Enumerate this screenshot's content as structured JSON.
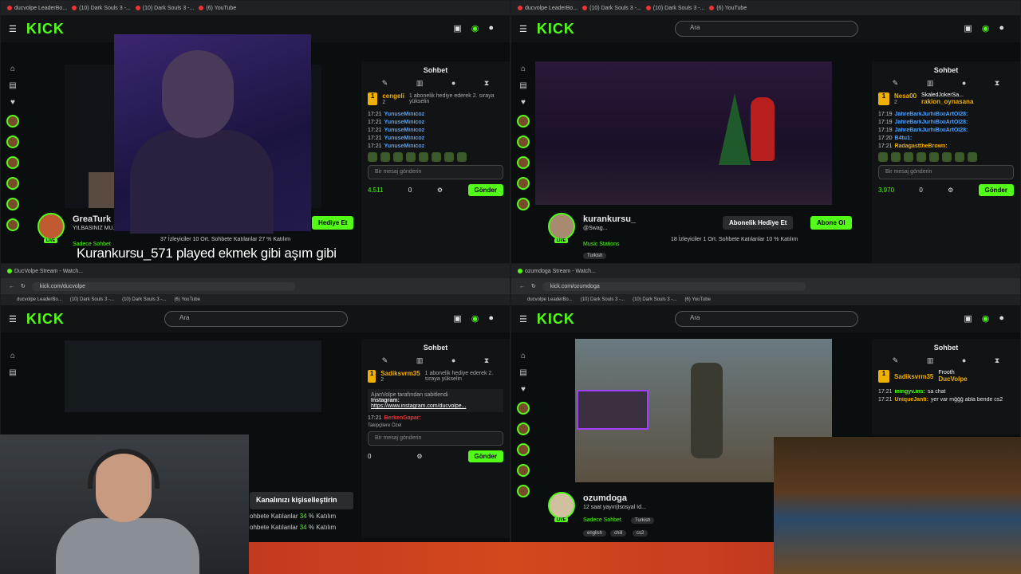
{
  "bookmarks": [
    "ducvolpe LeaderBo...",
    "(10) Dark Souls 3 -...",
    "(10) Dark Souls 3 -...",
    "(6) YouTube"
  ],
  "logo": "KICK",
  "search_placeholder": "Ara",
  "chat_title": "Sohbet",
  "chat_placeholder": "Bir mesaj gönderin",
  "send_label": "Gönder",
  "caption": "Kurankursu_571 played ekmek gibi aşım gibi",
  "q1": {
    "streamer": "GreaTurk",
    "subtitle": "YILBASINIZ MU...",
    "category": "Sadece Sohbet",
    "viewers": "37",
    "viewers_label": "İzleyiciler",
    "chatters": "10",
    "chatters_label": "Ort. Sohbete Katılanlar",
    "pct": "27",
    "pct_label": "% Katılım",
    "gift_btn": "Hediye Et",
    "gifter_name": "cengeli",
    "gifter_count": "2",
    "gifter_text": "1 abonelik hediye ederek 2. sıraya yükselin",
    "messages": [
      {
        "t": "17:21",
        "u": "YunuseMinicoz"
      },
      {
        "t": "17:21",
        "u": "YunuseMinicoz"
      },
      {
        "t": "17:21",
        "u": "YunuseMinicoz"
      },
      {
        "t": "17:21",
        "u": "YunuseMinicoz"
      },
      {
        "t": "17:21",
        "u": "YunuseMinicoz"
      }
    ],
    "points": "4.511",
    "zero": "0"
  },
  "q2": {
    "streamer": "kurankursu_",
    "handle": "@Swag...",
    "category": "Music Stations",
    "tag": "Turkish",
    "viewers": "18",
    "viewers_label": "İzleyiciler",
    "chatters": "1",
    "chatters_label": "Ort. Sohbete Katılanlar",
    "pct": "10",
    "pct_label": "% Katılım",
    "gift_btn": "Abonelik Hediye Et",
    "sub_btn": "Abone Ol",
    "gifter_name": "Nesa00",
    "gifter_count": "2",
    "gifter2": "SkaledJokerSa...",
    "gifter3": "rakion_oynasana",
    "messages": [
      {
        "t": "17:19",
        "u": "JahreBarkJurhiBixiArtOl28:"
      },
      {
        "t": "17:19",
        "u": "JahreBarkJurhiBixiArtOl28:"
      },
      {
        "t": "17:19",
        "u": "JahreBarkJurhiBixiArtOl28:"
      },
      {
        "t": "17:20",
        "u": "B4tu1:"
      },
      {
        "t": "17:21",
        "u": "RadagasttheBrown:"
      }
    ],
    "points": "3.970",
    "zero": "0"
  },
  "q3": {
    "tab_title": "DucVolpe Stream - Watch...",
    "url": "kick.com/ducvolpe",
    "gifter_name": "Sadiksvrm35",
    "gifter_count": "2",
    "gifter_text": "1 abonelik hediye ederek 2. sıraya yükselin",
    "pinned_by": "AjanVolpe tarafından sabitlendi",
    "pinned_label": "Instagram:",
    "pinned_link": "https://www.instagram.com/ducvolpe...",
    "msg_time": "17:21",
    "msg_user": "BerkenGapar:",
    "follow_note": "Takipçilere Özel",
    "customize_btn": "Kanalınızı kişiselleştirin",
    "stat1": "ohbete Katılanlar",
    "stat1_pct": "34",
    "stat2": "ohbete Katılanlar",
    "stat2_pct": "34",
    "pct_label": "% Katılım",
    "zero": "0"
  },
  "q4": {
    "tab_title": "ozumdoga Stream - Watch...",
    "url": "kick.com/ozumdoga",
    "streamer": "ozumdoga",
    "subtitle": "12 saat yayın|Isosyal Id...",
    "category": "Sadece Sohbet",
    "tags": [
      "Turkish",
      "english",
      "chill",
      "cs2"
    ],
    "gifter_name": "Sadiksvrm35",
    "gifter2": "Frooth",
    "gifter3": "DucVolpe",
    "messages": [
      {
        "t": "17:21",
        "u": "iningyv.ins:",
        "m": "sa chat"
      },
      {
        "t": "17:21",
        "u": "UniqueJanti:",
        "m": "yer var mğğğ abla bende cs2"
      }
    ]
  },
  "colors": {
    "accent": "#53fc18",
    "bg": "#0b0e0f",
    "gold": "#f0b000",
    "user": "#4fa3ff"
  }
}
